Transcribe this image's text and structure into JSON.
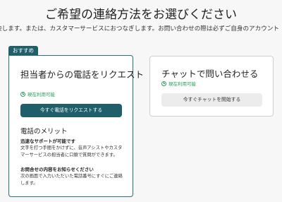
{
  "page_title": "ご希望の連絡方法をお選びください",
  "intro": "決します。または、カスタマーサービスにおつなぎします。お問い合わせの際は必ずご自身のアカウント",
  "call_card": {
    "badge": "おすすめ",
    "title": "担当者からの電話をリクエスト",
    "availability": "現在利用可能",
    "button": "今すぐ電話をリクエストする",
    "benefits_title": "電話のメリット",
    "benefits": [
      {
        "title": "迅速なサポートが可能です",
        "body": "文字を打つ手間をかけずに、音声アシストやカスタマーサービスの担当者に口頭で質問ができます。"
      },
      {
        "title": "お問合せの内容をお知らせください",
        "body": "次の画面で入力いただいた電話番号にすぐにご連絡します。"
      }
    ]
  },
  "chat_card": {
    "title": "チャットで問い合わせる",
    "availability": "現在利用可能",
    "button": "今すぐチャットを開始する"
  },
  "colors": {
    "accent": "#1f5f6a",
    "available": "#2a9d5c",
    "background": "#f7f7f7"
  }
}
